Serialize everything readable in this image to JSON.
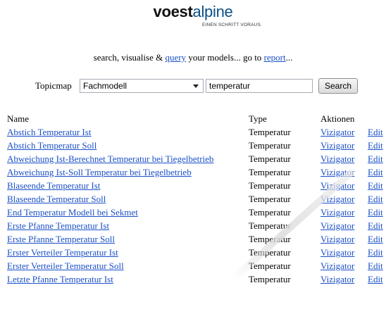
{
  "logo": {
    "word_1": "voest",
    "word_2": "alpine",
    "tagline": "EINEN SCHRITT VORAUS."
  },
  "intro": {
    "prefix": "search, visualise & ",
    "query_link": "query",
    "middle": " your models...  go to ",
    "report_link": "report",
    "suffix": "..."
  },
  "search": {
    "topicmap_label": "Topicmap",
    "topicmap_value": "Fachmodell",
    "query_value": "temperatur",
    "button_label": "Search"
  },
  "table": {
    "headers": {
      "name": "Name",
      "type": "Type",
      "actions": "Aktionen"
    },
    "rows": [
      {
        "name": "Abstich Temperatur Ist",
        "type": "Temperatur",
        "viz": "Vizigator",
        "edit": "Edit"
      },
      {
        "name": "Abstich Temperatur Soll",
        "type": "Temperatur",
        "viz": "Vizigator",
        "edit": "Edit"
      },
      {
        "name": "Abweichung Ist-Berechnet Temperatur bei Tiegelbetrieb",
        "type": "Temperatur",
        "viz": "Vizigator",
        "edit": "Edit"
      },
      {
        "name": "Abweichung Ist-Soll Temperatur bei Tiegelbetrieb",
        "type": "Temperatur",
        "viz": "Vizigator",
        "edit": "Edit"
      },
      {
        "name": "Blaseende Temperatur Ist",
        "type": "Temperatur",
        "viz": "Vizigator",
        "edit": "Edit"
      },
      {
        "name": "Blaseende Temperatur Soll",
        "type": "Temperatur",
        "viz": "Vizigator",
        "edit": "Edit"
      },
      {
        "name": "End Temperatur Modell bei Sekmet",
        "type": "Temperatur",
        "viz": "Vizigator",
        "edit": "Edit"
      },
      {
        "name": "Erste Pfanne Temperatur Ist",
        "type": "Temperatur",
        "viz": "Vizigator",
        "edit": "Edit"
      },
      {
        "name": "Erste Pfanne Temperatur Soll",
        "type": "Temperatur",
        "viz": "Vizigator",
        "edit": "Edit"
      },
      {
        "name": "Erster Verteiler Temperatur Ist",
        "type": "Temperatur",
        "viz": "Vizigator",
        "edit": "Edit"
      },
      {
        "name": "Erster Verteiler Temperatur Soll",
        "type": "Temperatur",
        "viz": "Vizigator",
        "edit": "Edit"
      },
      {
        "name": "Letzte Pfanne Temperatur Ist",
        "type": "Temperatur",
        "viz": "Vizigator",
        "edit": "Edit"
      }
    ]
  },
  "colors": {
    "link": "#1a4fc6",
    "brand": "#0b4f86"
  }
}
